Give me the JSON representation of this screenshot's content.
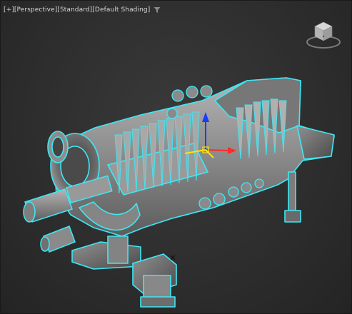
{
  "viewport": {
    "label_prefix": "[+]",
    "view_mode": "[Perspective]",
    "render_preset": "[Standard]",
    "shading_mode": "[Default Shading]",
    "filter_icon": "filter-funnel-icon",
    "viewcube_icon": "viewcube-icon",
    "colors": {
      "background": "#2e2e2e",
      "label_text": "#d6d6d6",
      "selection_outline": "#3de8f5",
      "model_body": "#8f8f8f",
      "gizmo_x": "#ff2a2a",
      "gizmo_y": "#ffe400",
      "gizmo_z": "#1a3cff"
    }
  },
  "scene": {
    "object": "gas-turbine-model",
    "selected": true
  }
}
